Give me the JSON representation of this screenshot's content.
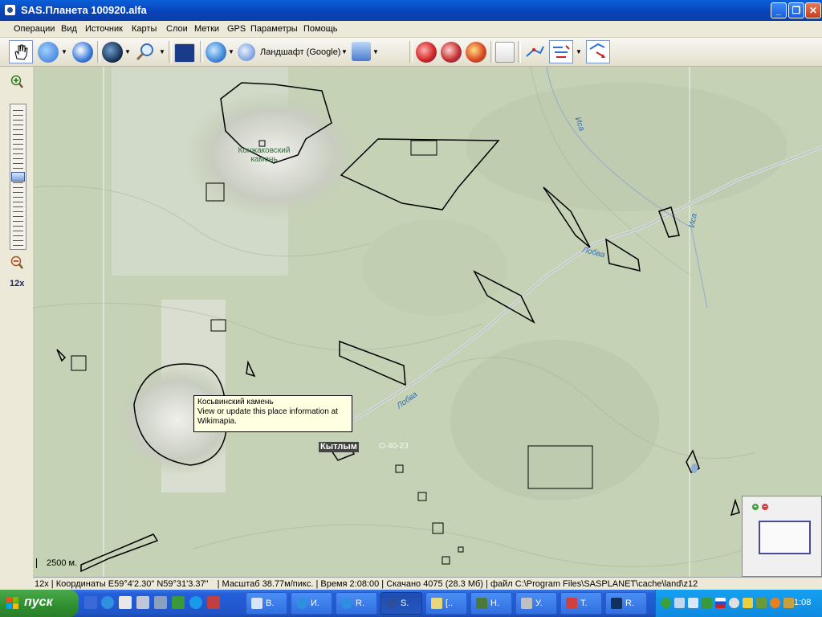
{
  "window": {
    "title": "SAS.Планета 100920.alfa",
    "buttons": {
      "minimize": "_",
      "maximize": "❐",
      "close": "✕"
    }
  },
  "menu": [
    "Операции",
    "Вид",
    "Источник",
    "Карты",
    "Слои",
    "Метки",
    "GPS",
    "Параметры",
    "Помощь"
  ],
  "toolbar": {
    "map_type": "Ландшафт (Google)"
  },
  "zoom": {
    "level_label": "12x",
    "plus_icon": "zoom-in-icon",
    "minus_icon": "zoom-out-icon"
  },
  "map": {
    "labels": {
      "konzhakovsky": "Конжаковский камень",
      "city": "Кытлым",
      "grid": "O-40-23",
      "rivers": [
        "Иса",
        "Иса",
        "Лобва",
        "Лобва"
      ]
    },
    "tooltip": {
      "title": "Косьвинский камень",
      "line1": "View or update this place information at",
      "line2": "Wikimapia."
    },
    "scale": "2500 м."
  },
  "status": {
    "zoom": "12x",
    "coords": "Координаты E59°4'2.30\" N59°31'3.37\"",
    "scale": "Масштаб 38.77м/пикс.",
    "time": "Время 2:08:00",
    "downloaded": "Скачано 4075 (28.3 Мб)",
    "file": "файл C:\\Program Files\\SASPLANET\\cache\\land\\z12"
  },
  "taskbar": {
    "start": "пуск",
    "tasks": [
      {
        "label": "В.",
        "color": "#d8e4f8"
      },
      {
        "label": "И.",
        "color": "#2f8fe0"
      },
      {
        "label": "R.",
        "color": "#2f8fe0"
      },
      {
        "label": "S.",
        "color": "#2a4f9e"
      },
      {
        "label": "[..",
        "color": "#e8d878"
      },
      {
        "label": "Н.",
        "color": "#4a7a3a"
      },
      {
        "label": "У.",
        "color": "#c0c0c0"
      },
      {
        "label": "Т.",
        "color": "#d04040"
      },
      {
        "label": "R.",
        "color": "#103060"
      }
    ],
    "clock": "1:08"
  },
  "colors": {
    "title_bar": "#0a5fd8",
    "taskbar": "#245edb",
    "start": "#2f8f2f",
    "map_bg": "#c4d0b4",
    "tooltip": "#ffffe1"
  }
}
